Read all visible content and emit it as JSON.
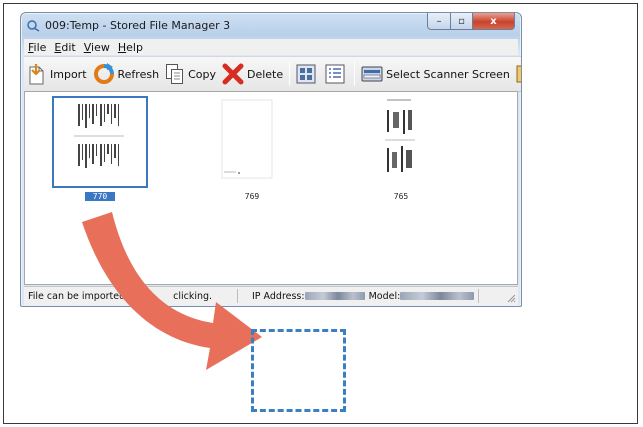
{
  "window": {
    "title": "009:Temp - Stored File Manager 3",
    "controls": {
      "minimize": "–",
      "maximize": "▫",
      "close": "x"
    }
  },
  "menu": [
    {
      "key": "F",
      "rest": "ile"
    },
    {
      "key": "E",
      "rest": "dit"
    },
    {
      "key": "V",
      "rest": "iew"
    },
    {
      "key": "H",
      "rest": "elp"
    }
  ],
  "toolbar": {
    "import_label": "Import",
    "refresh_label": "Refresh",
    "copy_label": "Copy",
    "delete_label": "Delete",
    "select_scanner_label": "Select Scanner Screen"
  },
  "thumbnails": [
    {
      "label": "770",
      "selected": true,
      "icon": "document-thumbnail-icon"
    },
    {
      "label": "769",
      "selected": false,
      "icon": "blank-page-thumbnail-icon"
    },
    {
      "label": "765",
      "selected": false,
      "icon": "document-thumbnail-icon"
    }
  ],
  "status": {
    "message_start": "File can be imported",
    "message_end": "clicking.",
    "ip_label": "IP Address:",
    "model_label": "Model:"
  },
  "colors": {
    "arrow": "#e8705a",
    "drop_target": "#3a7fc1",
    "selection": "#3b78c4",
    "close_button": "#c9432c"
  }
}
